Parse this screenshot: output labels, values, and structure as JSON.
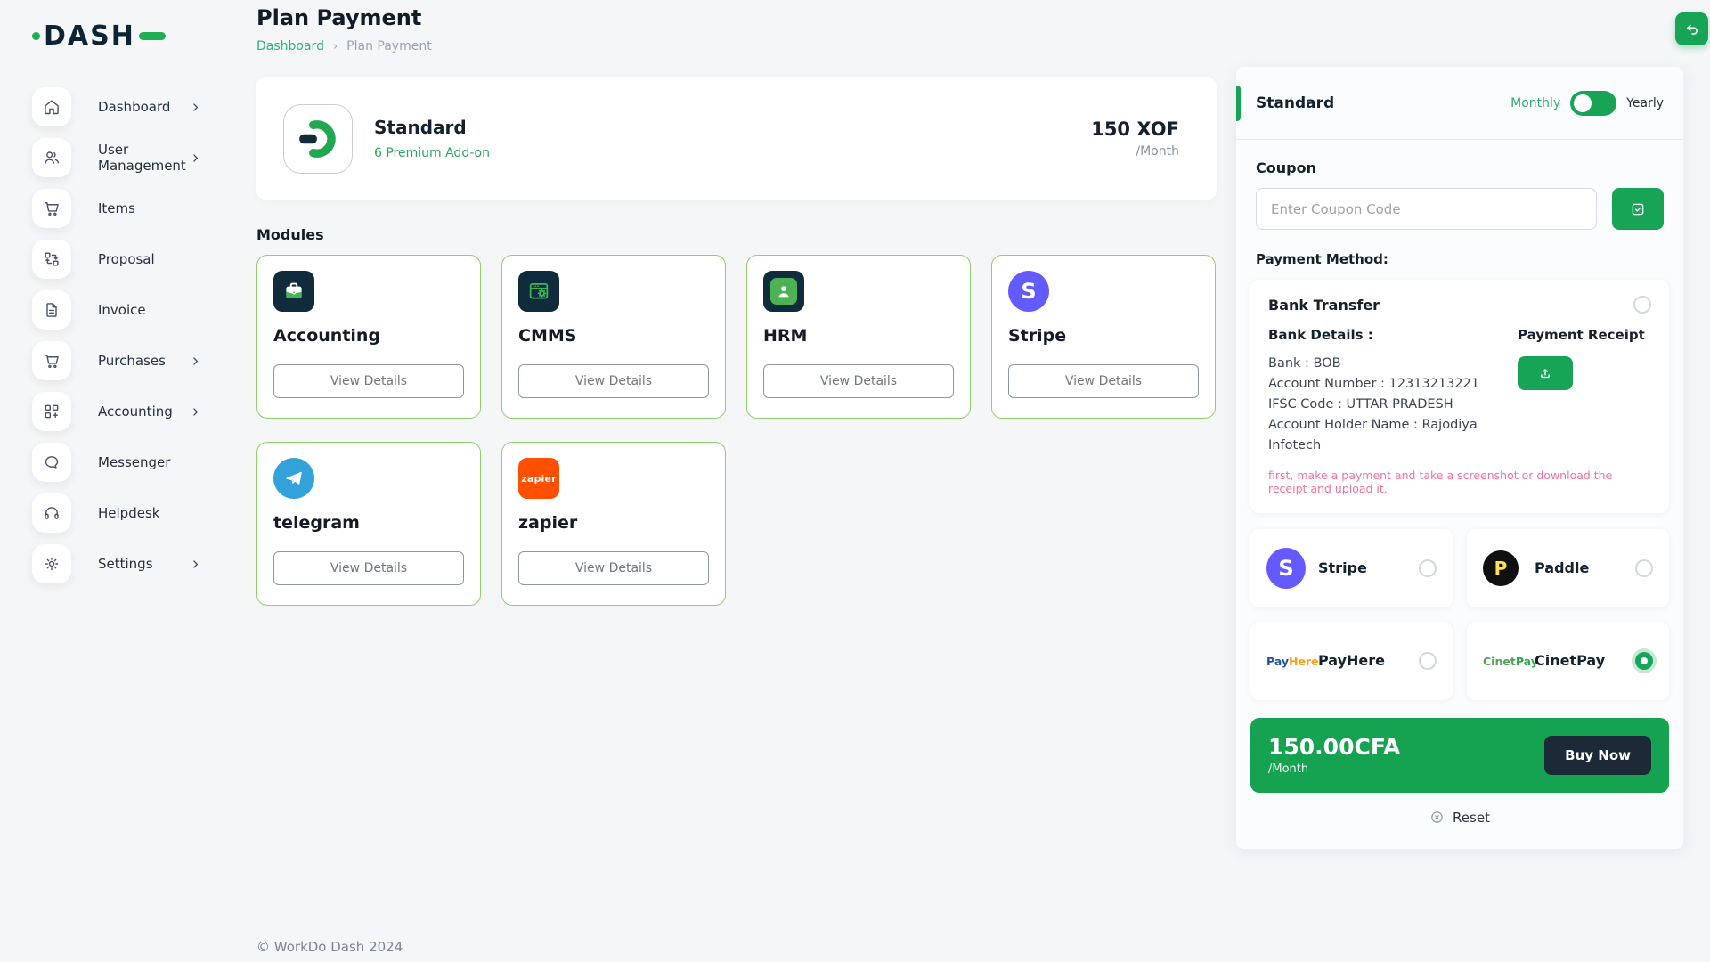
{
  "app": {
    "name": "DASH"
  },
  "header": {
    "title": "Plan Payment",
    "breadcrumb": {
      "home": "Dashboard",
      "separator": "›",
      "current": "Plan Payment"
    }
  },
  "sidebar": {
    "items": [
      {
        "label": "Dashboard",
        "icon": "home-icon",
        "has_chevron": true
      },
      {
        "label": "User Management",
        "icon": "users-icon",
        "has_chevron": true
      },
      {
        "label": "Items",
        "icon": "cart-icon",
        "has_chevron": false
      },
      {
        "label": "Proposal",
        "icon": "workflow-icon",
        "has_chevron": false
      },
      {
        "label": "Invoice",
        "icon": "document-icon",
        "has_chevron": false
      },
      {
        "label": "Purchases",
        "icon": "cart-icon",
        "has_chevron": true
      },
      {
        "label": "Accounting",
        "icon": "grid-plus-icon",
        "has_chevron": true
      },
      {
        "label": "Messenger",
        "icon": "chat-icon",
        "has_chevron": false
      },
      {
        "label": "Helpdesk",
        "icon": "headset-icon",
        "has_chevron": false
      },
      {
        "label": "Settings",
        "icon": "gear-icon",
        "has_chevron": true
      }
    ]
  },
  "plan_card": {
    "name": "Standard",
    "addons": "6 Premium Add-on",
    "price": "150 XOF",
    "period": "/Month"
  },
  "modules": {
    "heading": "Modules",
    "view_details_label": "View Details",
    "items": [
      {
        "name": "Accounting",
        "logo": "accounting-logo"
      },
      {
        "name": "CMMS",
        "logo": "cmms-logo"
      },
      {
        "name": "HRM",
        "logo": "hrm-logo"
      },
      {
        "name": "Stripe",
        "logo": "stripe-logo"
      },
      {
        "name": "telegram",
        "logo": "telegram-logo"
      },
      {
        "name": "zapier",
        "logo": "zapier-logo"
      }
    ]
  },
  "panel": {
    "plan_name": "Standard",
    "billing": {
      "monthly_label": "Monthly",
      "yearly_label": "Yearly",
      "selected": "Monthly"
    },
    "coupon": {
      "label": "Coupon",
      "placeholder": "Enter Coupon Code"
    },
    "payment_method_label": "Payment Method:",
    "bank_transfer": {
      "title": "Bank Transfer",
      "selected": false,
      "details_label": "Bank Details :",
      "receipt_label": "Payment Receipt",
      "lines": [
        "Bank : BOB",
        "Account Number : 12313213221",
        "IFSC Code : UTTAR PRADESH",
        "Account Holder Name : Rajodiya Infotech"
      ],
      "note": "first, make a payment and take a screenshot or download the receipt and upload it."
    },
    "options": [
      {
        "label": "Stripe",
        "logo": "stripe-logo",
        "selected": false
      },
      {
        "label": "Paddle",
        "logo": "paddle-logo",
        "selected": false
      },
      {
        "label": "PayHere",
        "logo": "payhere-logo",
        "selected": false
      },
      {
        "label": "CinetPay",
        "logo": "cinetpay-logo",
        "selected": true
      }
    ],
    "price": {
      "amount": "150.00CFA",
      "period": "/Month",
      "buy_label": "Buy Now"
    },
    "reset_label": "Reset"
  },
  "footer": {
    "copyright": "© WorkDo Dash 2024"
  },
  "colors": {
    "primary_green": "#17a457",
    "link_green": "#2eb47d",
    "module_border_green": "#8ed06b",
    "navy": "#0f2b3c",
    "stripe_purple": "#635bff",
    "telegram_blue": "#33a2da",
    "zapier_orange": "#ff4f00",
    "note_pink": "#f4719c",
    "banner_green": "#15a351",
    "buy_navy": "#1c2a38"
  }
}
